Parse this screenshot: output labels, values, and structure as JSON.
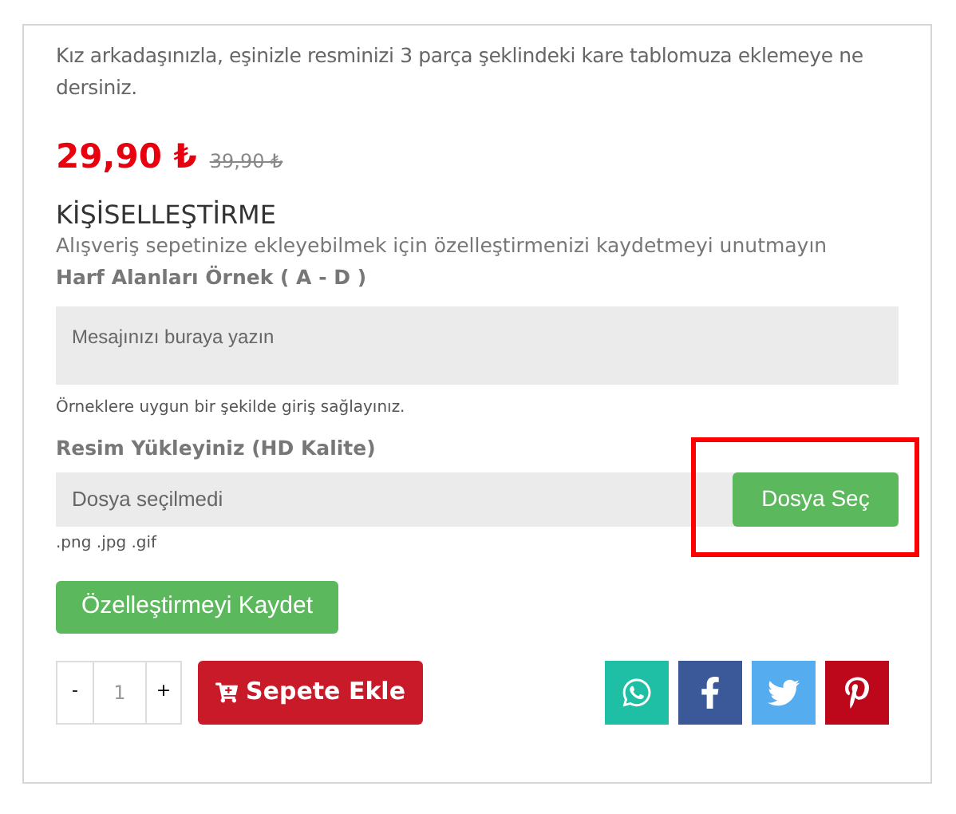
{
  "description": "Kız arkadaşınızla, eşinizle resminizi 3 parça şeklindeki kare tablomuza eklemeye ne dersiniz.",
  "price": {
    "current": "29,90 ₺",
    "old": "39,90 ₺"
  },
  "personalization": {
    "title": "KİŞİSELLEŞTİRME",
    "subtitle": "Alışveriş sepetinize ekleyebilmek için özelleştirmenizi kaydetmeyi unutmayın",
    "text_field": {
      "label": "Harf Alanları Örnek ( A - D )",
      "placeholder": "Mesajınızı buraya yazın",
      "hint": "Örneklere uygun bir şekilde giriş sağlayınız."
    },
    "upload": {
      "label": "Resim Yükleyiniz (HD Kalite)",
      "status": "Dosya seçilmedi",
      "button": "Dosya Seç",
      "formats": ".png .jpg .gif",
      "highlighted": true
    },
    "save_button": "Özelleştirmeyi Kaydet"
  },
  "quantity": {
    "minus": "-",
    "value": "1",
    "plus": "+"
  },
  "add_to_cart": "Sepete Ekle",
  "share": [
    {
      "kind": "whatsapp"
    },
    {
      "kind": "facebook"
    },
    {
      "kind": "twitter"
    },
    {
      "kind": "pinterest"
    }
  ]
}
